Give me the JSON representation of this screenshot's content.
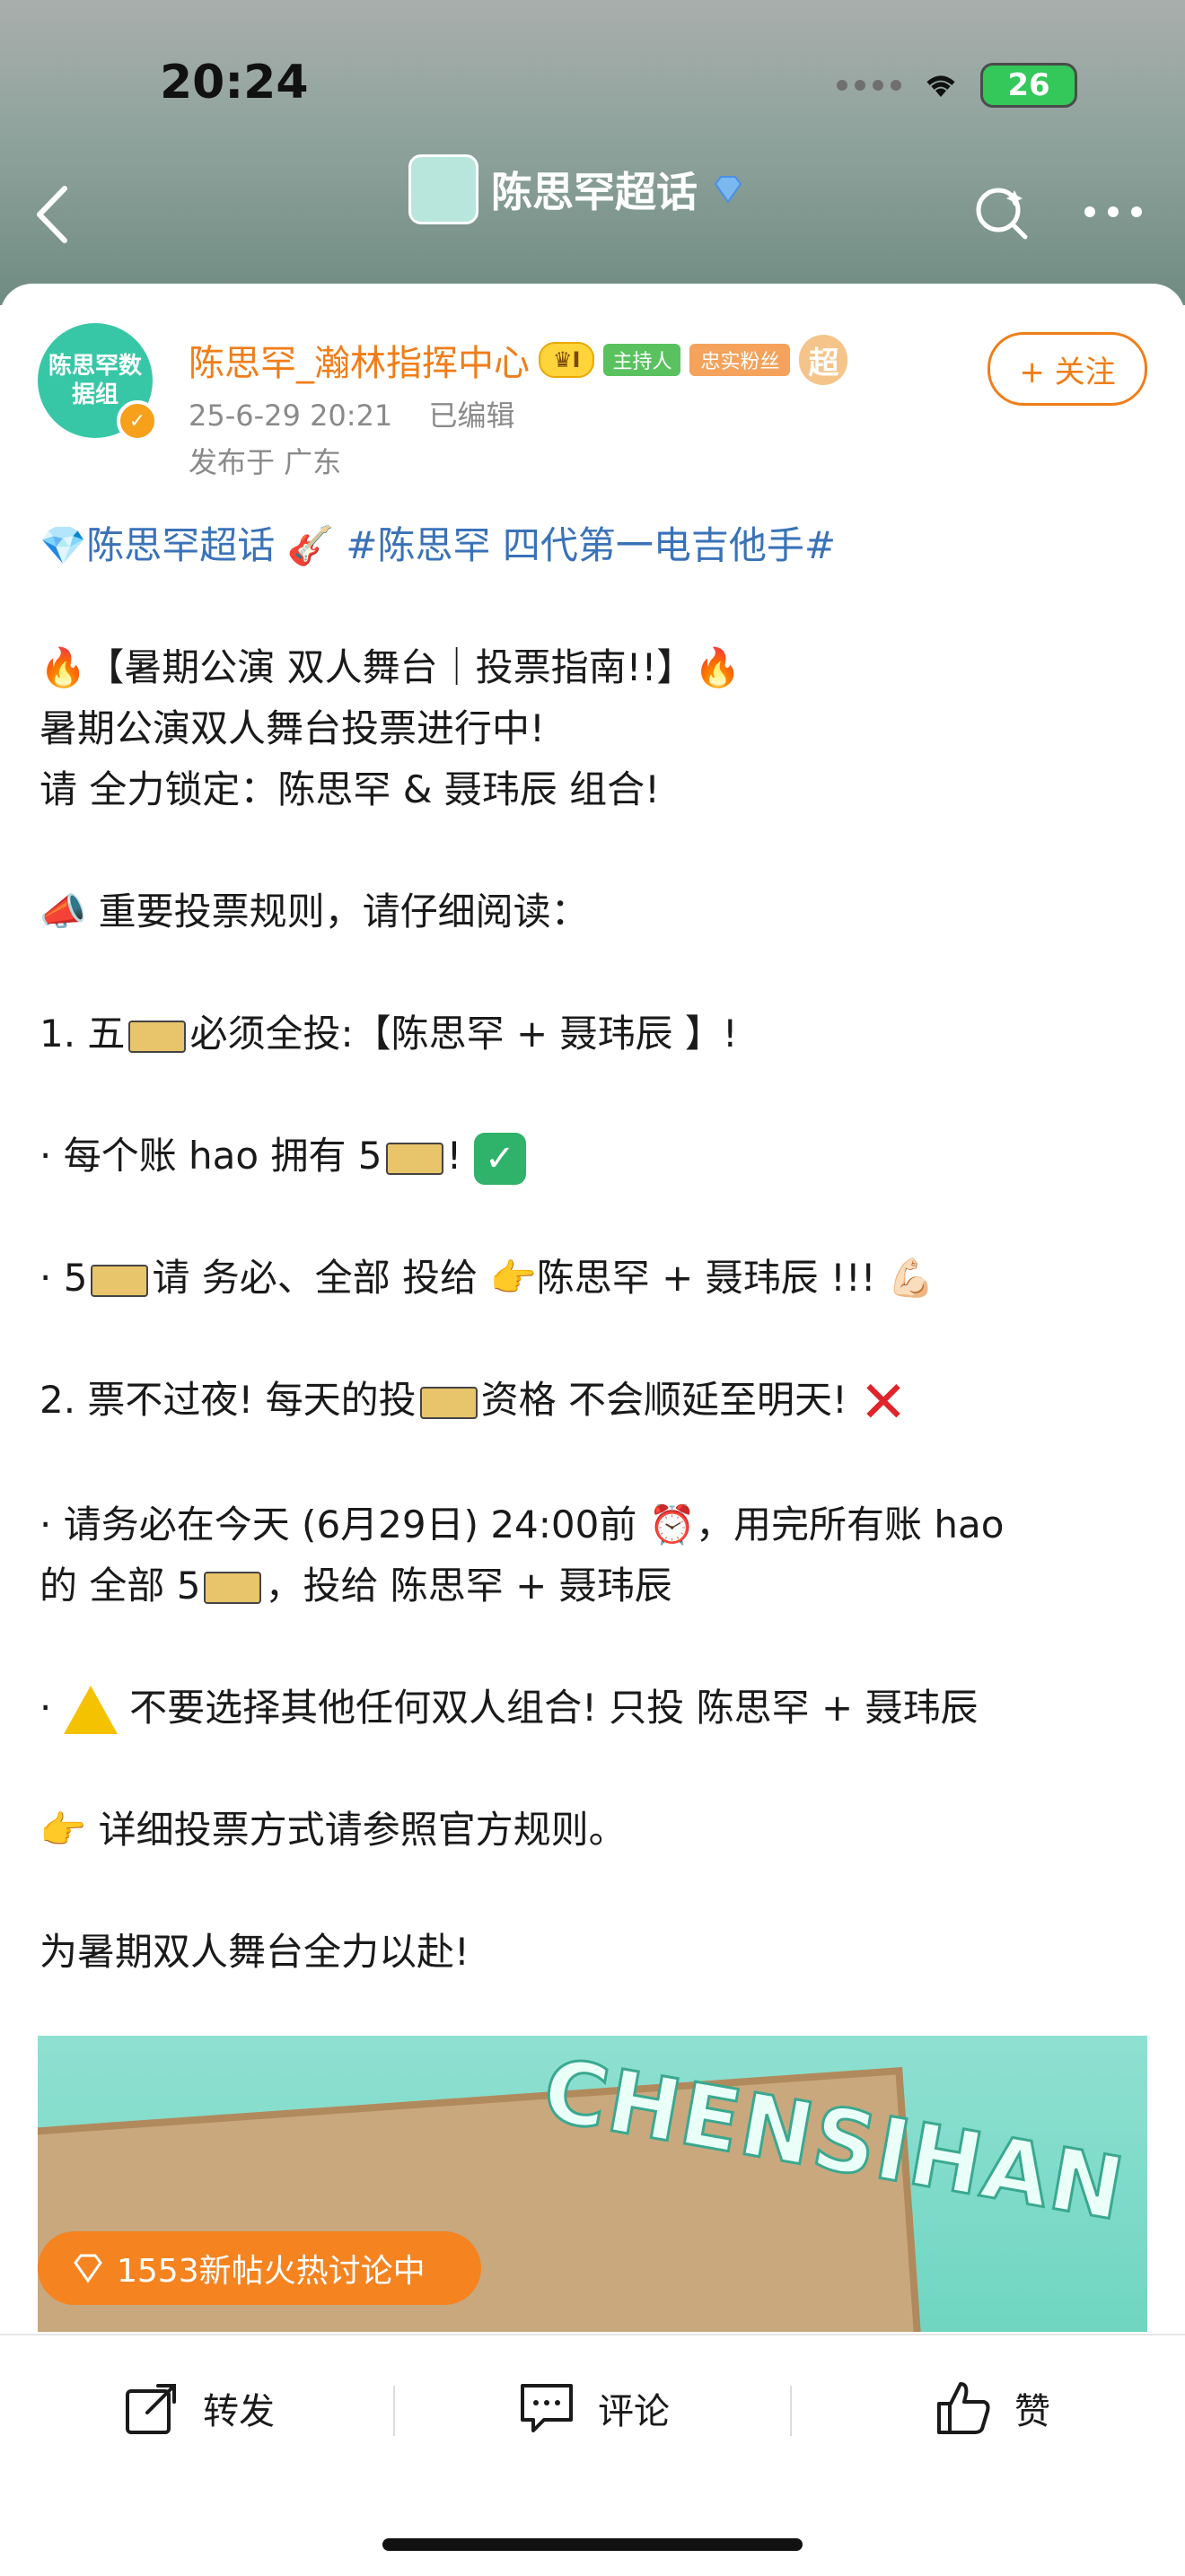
{
  "status_bar": {
    "time": "20:24",
    "battery": "26"
  },
  "header": {
    "title": "陈思罕超话"
  },
  "post": {
    "author": {
      "name": "陈思罕_瀚林指挥中心",
      "avatar_text": "陈思罕数据组",
      "crown_badge": "I",
      "host_badge": "主持人",
      "fan_badge": "忠实粉丝",
      "super_badge": "超"
    },
    "follow_label": "+ 关注",
    "timestamp": "25-6-29 20:21",
    "edited_label": "已编辑",
    "location": "发布于 广东",
    "topic_line": "💎陈思罕超话 🎸 #陈思罕 四代第一电吉他手#",
    "lines": {
      "l1": "🔥【暑期公演 双人舞台｜投票指南!!】🔥",
      "l2": "暑期公演双人舞台投票进行中!",
      "l3": "请 全力锁定：陈思罕 & 聂玮辰 组合!",
      "l4": "📣 重要投票规则，请仔细阅读：",
      "l5a": "1. 五",
      "l5b": "必须全投:【陈思罕 + 聂玮辰 】!",
      "l6a": "· 每个账 hao 拥有 5",
      "l6b": "!",
      "l7a": "· 5",
      "l7b": "请 务必、全部 投给 👉陈思罕 + 聂玮辰 !!! 💪🏻",
      "l8a": "2. 票不过夜!  每天的投",
      "l8b": "资格 不会顺延至明天!",
      "l9": "· 请务必在今天 (6月29日) 24:00前 ⏰，用完所有账 hao",
      "l10a": "的 全部 5",
      "l10b": "，投给 陈思罕 + 聂玮辰",
      "l11a": "·",
      "l11b": "不要选择其他任何双人组合!  只投 陈思罕 + 聂玮辰",
      "l12": "👉  详细投票方式请参照官方规则。",
      "l13": "为暑期双人舞台全力以赴!"
    },
    "image_text": "CHENSIHAN",
    "cross_mark": "✕",
    "check_mark": "✓"
  },
  "hot_pill": "1553新帖火热讨论中",
  "bottom_bar": {
    "repost": "转发",
    "comment": "评论",
    "like": "赞"
  },
  "colors": {
    "accent": "#f07d18",
    "topic": "#3a72b8",
    "header_bg": "#8fa39c"
  }
}
